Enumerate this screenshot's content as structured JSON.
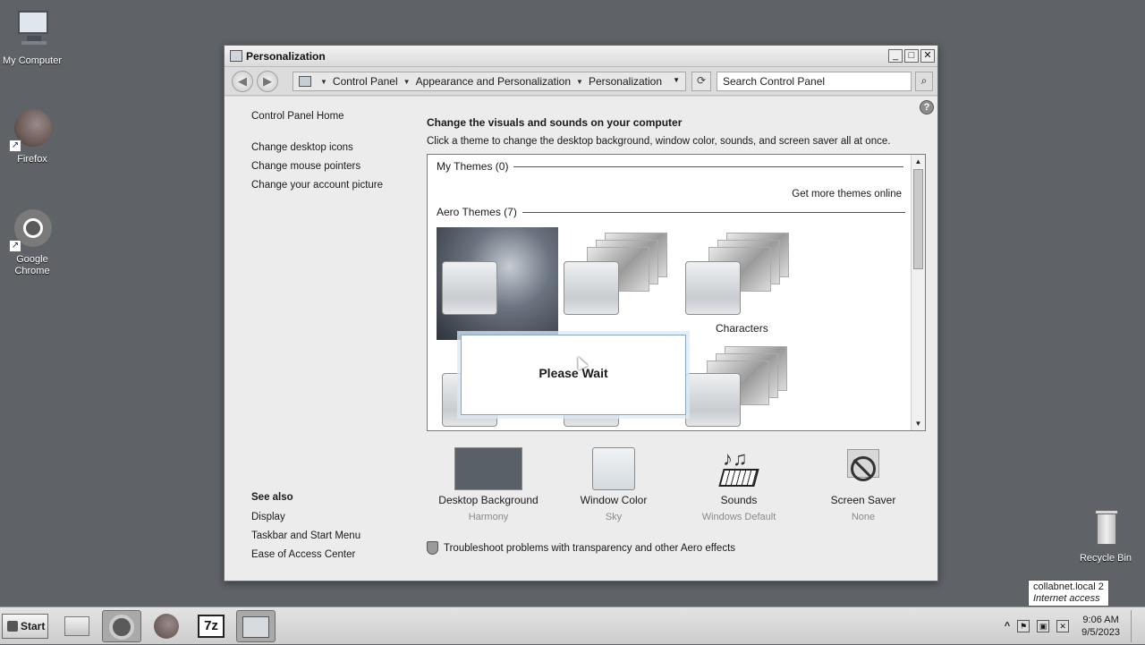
{
  "desktop": {
    "icons": [
      {
        "label": "My Computer"
      },
      {
        "label": "Firefox"
      },
      {
        "label": "Google Chrome"
      },
      {
        "label": "Recycle Bin"
      }
    ]
  },
  "window": {
    "title": "Personalization",
    "buttons": {
      "minimize": "_",
      "maximize": "□",
      "close": "✕"
    }
  },
  "addressbar": {
    "breadcrumbs": [
      "Control Panel",
      "Appearance and Personalization",
      "Personalization"
    ],
    "search_placeholder": "Search Control Panel",
    "back": "◀",
    "forward": "▶",
    "refresh": "⟳",
    "search_icon": "⌕"
  },
  "sidebar": {
    "home": "Control Panel Home",
    "links": [
      "Change desktop icons",
      "Change mouse pointers",
      "Change your account picture"
    ],
    "see_also_title": "See also",
    "see_also": [
      "Display",
      "Taskbar and Start Menu",
      "Ease of Access Center"
    ]
  },
  "main": {
    "title": "Change the visuals and sounds on your computer",
    "subtitle": "Click a theme to change the desktop background, window color, sounds, and screen saver all at once.",
    "help": "?",
    "my_themes_header": "My Themes (0)",
    "get_more": "Get more themes online",
    "aero_themes_header": "Aero Themes (7)",
    "themes": [
      {
        "name": "Characters"
      }
    ],
    "please_wait": "Please Wait"
  },
  "bottom": {
    "items": [
      {
        "name": "Desktop Background",
        "value": "Harmony",
        "icon": "desktop-background-swatch"
      },
      {
        "name": "Window Color",
        "value": "Sky",
        "icon": "window-color-swatch"
      },
      {
        "name": "Sounds",
        "value": "Windows Default",
        "icon": "music-keyboard-icon"
      },
      {
        "name": "Screen Saver",
        "value": "None",
        "icon": "screen-saver-none-icon"
      }
    ],
    "troubleshoot": "Troubleshoot problems with transparency and other Aero effects"
  },
  "taskbar": {
    "start": "Start",
    "items": [
      {
        "icon": "file-manager-icon"
      },
      {
        "icon": "chrome-icon"
      },
      {
        "icon": "firefox-icon"
      },
      {
        "icon": "7zip-icon",
        "label": "7z"
      },
      {
        "icon": "control-panel-icon"
      }
    ],
    "tray": {
      "expand": "^",
      "time": "9:06 AM",
      "date": "9/5/2023"
    }
  },
  "tooltip": {
    "line1": "collabnet.local  2",
    "line2": "Internet access"
  },
  "colors": {
    "desktop": "#5f6368",
    "window_bg": "#ececec",
    "dialog_border": "#8ba6c3"
  }
}
